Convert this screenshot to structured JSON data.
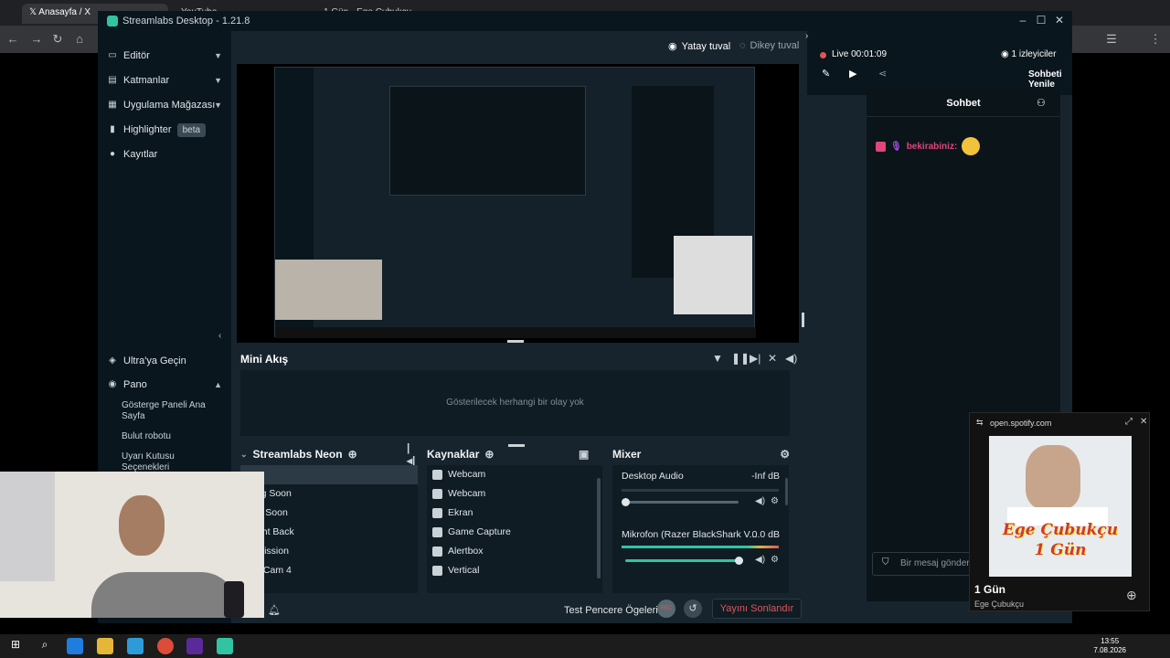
{
  "browser": {
    "tabs": [
      "Anasayfa / X",
      "YouTube",
      "1 Gün - Ege Çubukçu"
    ],
    "new_tab": "+"
  },
  "app": {
    "title": "Streamlabs Desktop - 1.21.8"
  },
  "sidebar": {
    "items": [
      {
        "label": "Editör"
      },
      {
        "label": "Katmanlar"
      },
      {
        "label": "Uygulama Mağazası"
      },
      {
        "label": "Highlighter",
        "badge": "beta"
      },
      {
        "label": "Kayıtlar"
      }
    ],
    "ultra": "Ultra'ya Geçin",
    "panel": "Pano",
    "panel_items": [
      "Gösterge Paneli Ana Sayfa",
      "Bulut robotu",
      "Uyarı Kutusu Seçenekleri"
    ]
  },
  "canvas": {
    "horizontal": "Yatay tuval",
    "vertical": "Dikey tuval"
  },
  "mini_feed": {
    "title": "Mini Akış",
    "empty": "Gösterilecek herhangi bir olay yok"
  },
  "scenes": {
    "title": "Streamlabs Neon",
    "items": [
      "e",
      "rting Soon",
      "ling Soon",
      "Right Back",
      "ermission",
      "lab Cam 4"
    ]
  },
  "sources": {
    "title": "Kaynaklar",
    "items": [
      "Webcam",
      "Webcam",
      "Ekran",
      "Game Capture",
      "Alertbox",
      "Vertical"
    ]
  },
  "mixer": {
    "title": "Mixer",
    "channels": [
      {
        "name": "Desktop Audio",
        "db": "-Inf dB",
        "volume": 0.0
      },
      {
        "name": "Mikrofon (Razer BlackShark V...",
        "db": "0.0 dB",
        "volume": 1.0
      }
    ]
  },
  "footer": {
    "test_label": "Test Pencere Ögeleri",
    "rec": "REC",
    "end_stream": "Yayını Sonlandır"
  },
  "live": {
    "status": "Live 00:01:09",
    "viewers": "1 izleyiciler",
    "refresh_chat": "Sohbeti Yenile"
  },
  "chat": {
    "title": "Sohbet",
    "message_user": "bekirabiniz:",
    "input_placeholder": "Bir mesaj gönder"
  },
  "spotify": {
    "url": "open.spotify.com",
    "song": "1 Gün",
    "artist": "Ege Çubukçu",
    "album_text": "Ege Çubukçu 1 Gün"
  },
  "taskbar": {
    "time": "13:55",
    "date": "7.08.2026"
  }
}
